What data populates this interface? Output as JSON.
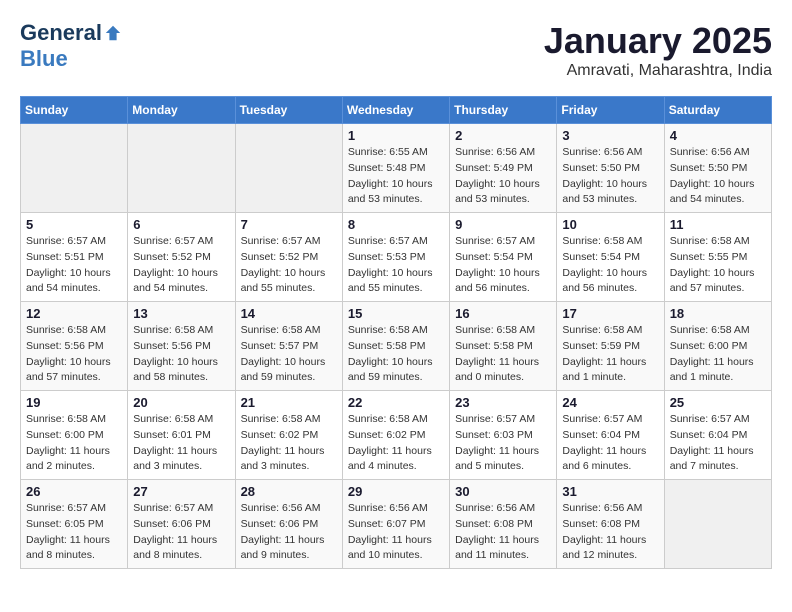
{
  "header": {
    "logo_general": "General",
    "logo_blue": "Blue",
    "title": "January 2025",
    "subtitle": "Amravati, Maharashtra, India"
  },
  "days_of_week": [
    "Sunday",
    "Monday",
    "Tuesday",
    "Wednesday",
    "Thursday",
    "Friday",
    "Saturday"
  ],
  "weeks": [
    [
      {
        "day": "",
        "info": ""
      },
      {
        "day": "",
        "info": ""
      },
      {
        "day": "",
        "info": ""
      },
      {
        "day": "1",
        "info": "Sunrise: 6:55 AM\nSunset: 5:48 PM\nDaylight: 10 hours and 53 minutes."
      },
      {
        "day": "2",
        "info": "Sunrise: 6:56 AM\nSunset: 5:49 PM\nDaylight: 10 hours and 53 minutes."
      },
      {
        "day": "3",
        "info": "Sunrise: 6:56 AM\nSunset: 5:50 PM\nDaylight: 10 hours and 53 minutes."
      },
      {
        "day": "4",
        "info": "Sunrise: 6:56 AM\nSunset: 5:50 PM\nDaylight: 10 hours and 54 minutes."
      }
    ],
    [
      {
        "day": "5",
        "info": "Sunrise: 6:57 AM\nSunset: 5:51 PM\nDaylight: 10 hours and 54 minutes."
      },
      {
        "day": "6",
        "info": "Sunrise: 6:57 AM\nSunset: 5:52 PM\nDaylight: 10 hours and 54 minutes."
      },
      {
        "day": "7",
        "info": "Sunrise: 6:57 AM\nSunset: 5:52 PM\nDaylight: 10 hours and 55 minutes."
      },
      {
        "day": "8",
        "info": "Sunrise: 6:57 AM\nSunset: 5:53 PM\nDaylight: 10 hours and 55 minutes."
      },
      {
        "day": "9",
        "info": "Sunrise: 6:57 AM\nSunset: 5:54 PM\nDaylight: 10 hours and 56 minutes."
      },
      {
        "day": "10",
        "info": "Sunrise: 6:58 AM\nSunset: 5:54 PM\nDaylight: 10 hours and 56 minutes."
      },
      {
        "day": "11",
        "info": "Sunrise: 6:58 AM\nSunset: 5:55 PM\nDaylight: 10 hours and 57 minutes."
      }
    ],
    [
      {
        "day": "12",
        "info": "Sunrise: 6:58 AM\nSunset: 5:56 PM\nDaylight: 10 hours and 57 minutes."
      },
      {
        "day": "13",
        "info": "Sunrise: 6:58 AM\nSunset: 5:56 PM\nDaylight: 10 hours and 58 minutes."
      },
      {
        "day": "14",
        "info": "Sunrise: 6:58 AM\nSunset: 5:57 PM\nDaylight: 10 hours and 59 minutes."
      },
      {
        "day": "15",
        "info": "Sunrise: 6:58 AM\nSunset: 5:58 PM\nDaylight: 10 hours and 59 minutes."
      },
      {
        "day": "16",
        "info": "Sunrise: 6:58 AM\nSunset: 5:58 PM\nDaylight: 11 hours and 0 minutes."
      },
      {
        "day": "17",
        "info": "Sunrise: 6:58 AM\nSunset: 5:59 PM\nDaylight: 11 hours and 1 minute."
      },
      {
        "day": "18",
        "info": "Sunrise: 6:58 AM\nSunset: 6:00 PM\nDaylight: 11 hours and 1 minute."
      }
    ],
    [
      {
        "day": "19",
        "info": "Sunrise: 6:58 AM\nSunset: 6:00 PM\nDaylight: 11 hours and 2 minutes."
      },
      {
        "day": "20",
        "info": "Sunrise: 6:58 AM\nSunset: 6:01 PM\nDaylight: 11 hours and 3 minutes."
      },
      {
        "day": "21",
        "info": "Sunrise: 6:58 AM\nSunset: 6:02 PM\nDaylight: 11 hours and 3 minutes."
      },
      {
        "day": "22",
        "info": "Sunrise: 6:58 AM\nSunset: 6:02 PM\nDaylight: 11 hours and 4 minutes."
      },
      {
        "day": "23",
        "info": "Sunrise: 6:57 AM\nSunset: 6:03 PM\nDaylight: 11 hours and 5 minutes."
      },
      {
        "day": "24",
        "info": "Sunrise: 6:57 AM\nSunset: 6:04 PM\nDaylight: 11 hours and 6 minutes."
      },
      {
        "day": "25",
        "info": "Sunrise: 6:57 AM\nSunset: 6:04 PM\nDaylight: 11 hours and 7 minutes."
      }
    ],
    [
      {
        "day": "26",
        "info": "Sunrise: 6:57 AM\nSunset: 6:05 PM\nDaylight: 11 hours and 8 minutes."
      },
      {
        "day": "27",
        "info": "Sunrise: 6:57 AM\nSunset: 6:06 PM\nDaylight: 11 hours and 8 minutes."
      },
      {
        "day": "28",
        "info": "Sunrise: 6:56 AM\nSunset: 6:06 PM\nDaylight: 11 hours and 9 minutes."
      },
      {
        "day": "29",
        "info": "Sunrise: 6:56 AM\nSunset: 6:07 PM\nDaylight: 11 hours and 10 minutes."
      },
      {
        "day": "30",
        "info": "Sunrise: 6:56 AM\nSunset: 6:08 PM\nDaylight: 11 hours and 11 minutes."
      },
      {
        "day": "31",
        "info": "Sunrise: 6:56 AM\nSunset: 6:08 PM\nDaylight: 11 hours and 12 minutes."
      },
      {
        "day": "",
        "info": ""
      }
    ]
  ]
}
